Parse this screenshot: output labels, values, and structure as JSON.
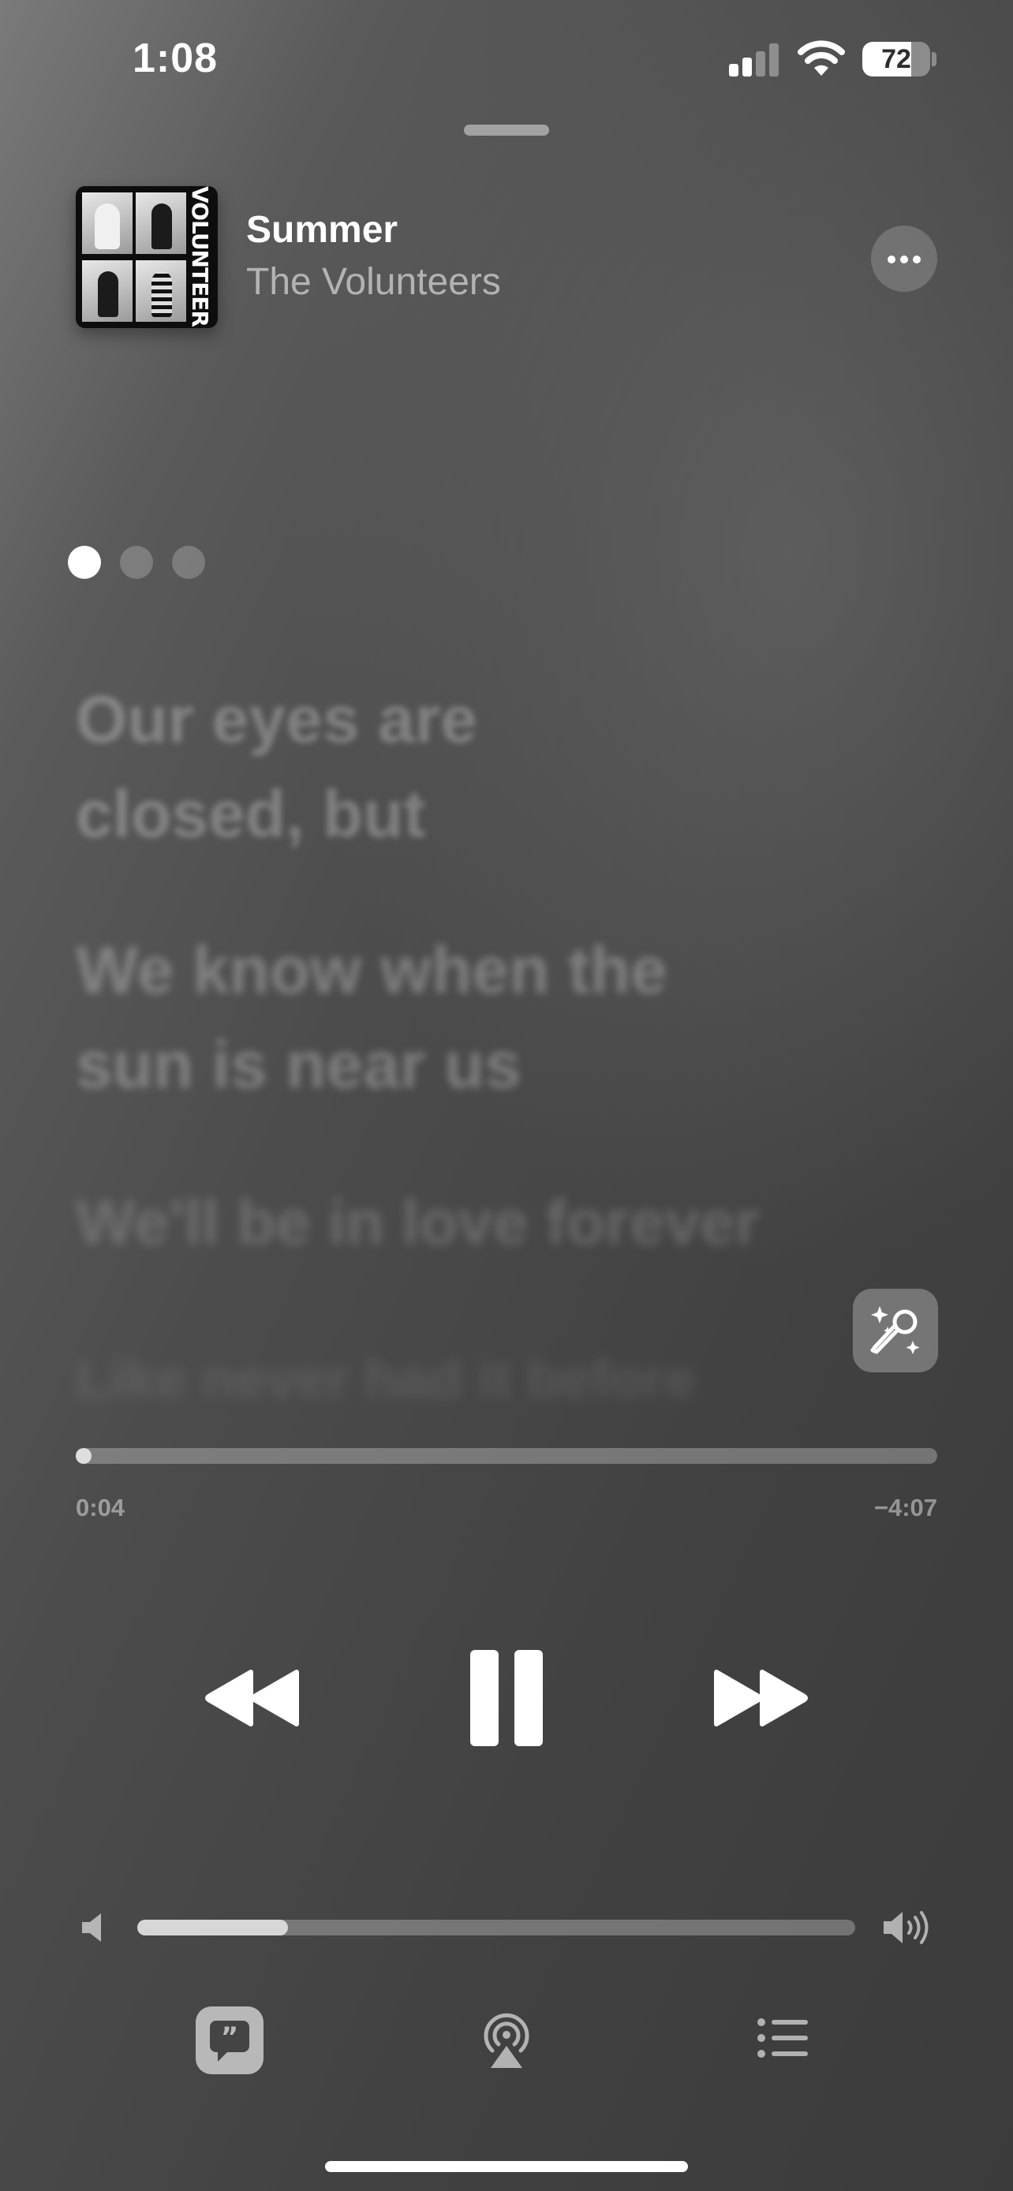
{
  "status_bar": {
    "time": "1:08",
    "battery_level": "72",
    "icons": [
      "cellular-signal-icon",
      "wifi-icon",
      "battery-icon"
    ]
  },
  "now_playing": {
    "artwork_text": "VOLUNTEERS",
    "title": "Summer",
    "artist": "The Volunteers",
    "more_icon": "ellipsis-icon"
  },
  "pages": {
    "count": 3,
    "active": 0
  },
  "lyrics": {
    "lines": [
      "Our eyes are closed, but",
      "We know when the sun is near us",
      "We'll be in love forever",
      "Like never had it before"
    ]
  },
  "playback": {
    "elapsed": "0:04",
    "remaining": "−4:07",
    "progress_fraction": 0.016,
    "state": "playing"
  },
  "volume": {
    "level_fraction": 0.21
  },
  "toolbar": {
    "items": [
      "lyrics-icon",
      "airplay-icon",
      "queue-icon"
    ],
    "active": "lyrics-icon"
  },
  "colors": {
    "accent": "#ffffff",
    "background_top": "#7a7a7a",
    "background_bottom": "#3b3b3b"
  }
}
